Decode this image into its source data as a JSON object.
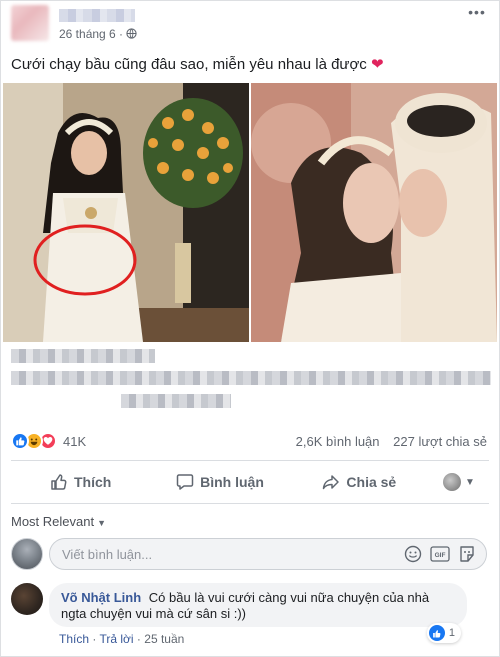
{
  "post": {
    "date": "26 tháng 6 ·",
    "more_icon": "more-horizontal-icon",
    "caption": "Cưới chạy bầu cũng đâu sao, miễn yêu nhau là được",
    "caption_emoji": "❤"
  },
  "reactions": {
    "count": "41K",
    "comments": "2,6K bình luận",
    "shares": "227 lượt chia sẻ"
  },
  "actions": {
    "like": "Thích",
    "comment": "Bình luận",
    "share": "Chia sẻ"
  },
  "comments_section": {
    "sort_label": "Most Relevant",
    "input_placeholder": "Viết bình luận...",
    "gif_label": "GIF"
  },
  "comment": {
    "author": "Võ Nhật Linh",
    "text": "Có bầu là vui cưới càng vui nữa chuyện của nhà ngta chuyện vui mà cứ sân si :))",
    "like_label": "Thích",
    "reply_label": "Trả lời",
    "age": "25 tuần",
    "like_count": "1"
  },
  "colors": {
    "link": "#385898",
    "like_blue": "#1877f2",
    "love_red": "#f33e58",
    "haha_yellow": "#f7b125",
    "circle_annotation": "#e02020"
  }
}
